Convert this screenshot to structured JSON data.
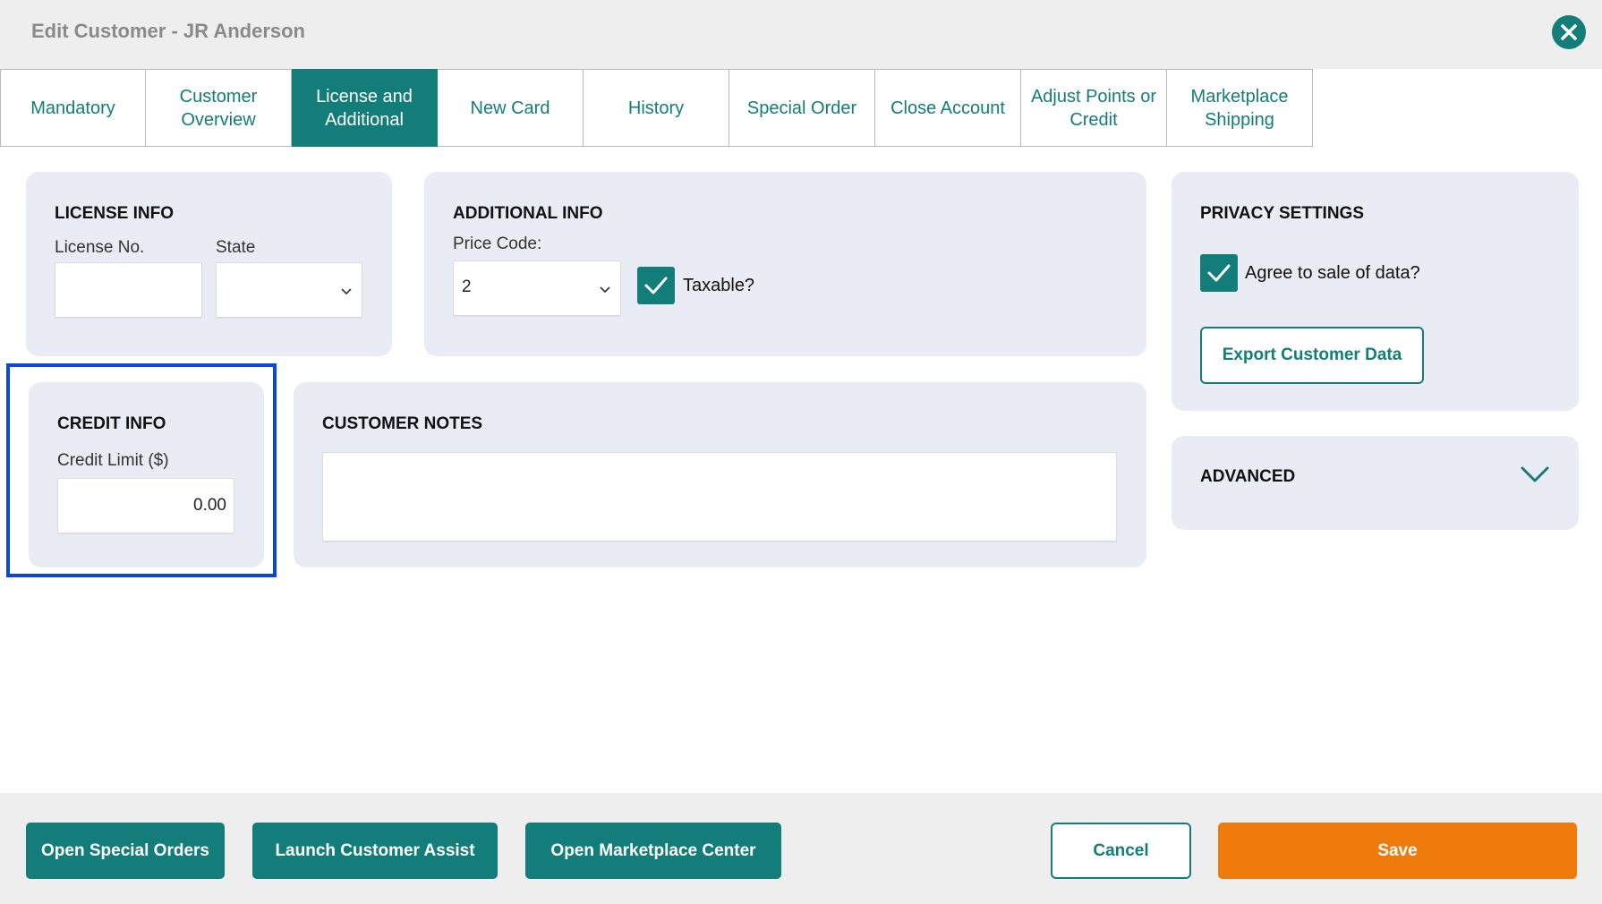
{
  "window": {
    "title": "Edit Customer - JR Anderson"
  },
  "tabs": [
    {
      "label": "Mandatory"
    },
    {
      "label": "Customer Overview"
    },
    {
      "label": "License and Additional"
    },
    {
      "label": "New Card"
    },
    {
      "label": "History"
    },
    {
      "label": "Special Order"
    },
    {
      "label": "Close Account"
    },
    {
      "label": "Adjust Points or Credit"
    },
    {
      "label": "Marketplace Shipping"
    }
  ],
  "active_tab": "License and Additional",
  "license_info": {
    "title": "LICENSE INFO",
    "license_no_label": "License No.",
    "license_no_value": "",
    "state_label": "State",
    "state_value": ""
  },
  "additional_info": {
    "title": "ADDITIONAL INFO",
    "price_code_label": "Price Code:",
    "price_code_value": "2",
    "taxable_label": "Taxable?",
    "taxable_checked": true
  },
  "privacy_settings": {
    "title": "PRIVACY SETTINGS",
    "agree_label": "Agree to sale of data?",
    "agree_checked": true,
    "export_button": "Export Customer Data"
  },
  "credit_info": {
    "title": "CREDIT INFO",
    "credit_limit_label": "Credit Limit ($)",
    "credit_limit_value": "0.00"
  },
  "customer_notes": {
    "title": "CUSTOMER NOTES",
    "value": ""
  },
  "advanced": {
    "title": "ADVANCED"
  },
  "footer": {
    "open_special_orders": "Open Special Orders",
    "launch_customer_assist": "Launch Customer Assist",
    "open_marketplace_center": "Open Marketplace Center",
    "cancel": "Cancel",
    "save": "Save"
  },
  "colors": {
    "accent": "#127d79",
    "save": "#ee7b0b",
    "card_bg": "#e9ecf4",
    "highlight": "#0a47e0"
  },
  "icons": {
    "close": "close-icon",
    "chevron": "chevron-down-icon",
    "check": "check-icon"
  }
}
